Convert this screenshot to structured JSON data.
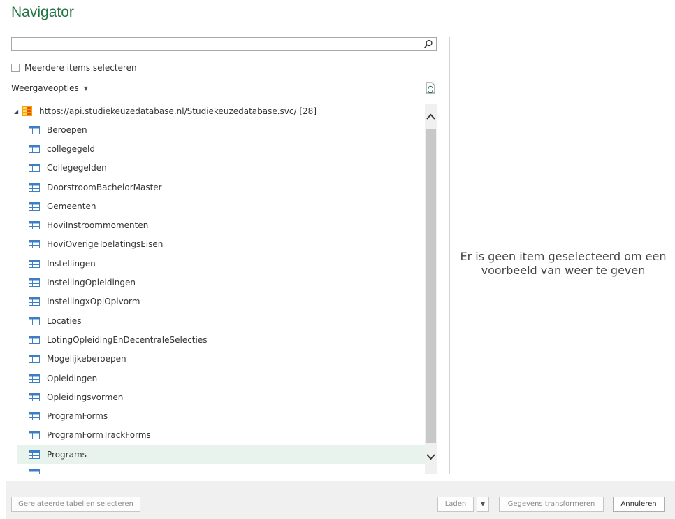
{
  "title": "Navigator",
  "search": {
    "placeholder": "",
    "value": ""
  },
  "multi_select": {
    "label": "Meerdere items selecteren",
    "checked": false
  },
  "view_options": {
    "label": "Weergaveopties"
  },
  "tree": {
    "root": {
      "label": "https://api.studiekeuzedatabase.nl/Studiekeuzedatabase.svc/ [28]",
      "expanded": true
    },
    "items": [
      {
        "label": "Beroepen"
      },
      {
        "label": "collegegeld"
      },
      {
        "label": "Collegegelden"
      },
      {
        "label": "DoorstroomBachelorMaster"
      },
      {
        "label": "Gemeenten"
      },
      {
        "label": "HoviInstroommomenten"
      },
      {
        "label": "HoviOverigeToelatingsEisen"
      },
      {
        "label": "Instellingen"
      },
      {
        "label": "InstellingOpleidingen"
      },
      {
        "label": "InstellingxOplOplvorm"
      },
      {
        "label": "Locaties"
      },
      {
        "label": "LotingOpleidingEnDecentraleSelecties"
      },
      {
        "label": "Mogelijkeberoepen"
      },
      {
        "label": "Opleidingen"
      },
      {
        "label": "Opleidingsvormen"
      },
      {
        "label": "ProgramForms"
      },
      {
        "label": "ProgramFormTrackForms"
      },
      {
        "label": "Programs",
        "hovered": true
      }
    ]
  },
  "preview": {
    "message": "Er is geen item geselecteerd om een voorbeeld van weer te geven"
  },
  "footer": {
    "related_tables_label": "Gerelateerde tabellen selecteren",
    "load_label": "Laden",
    "transform_label": "Gegevens transformeren",
    "cancel_label": "Annuleren"
  },
  "colors": {
    "accent": "#217346",
    "hover_row": "#e9f3ee",
    "footer_bg": "#f0f0f0"
  }
}
